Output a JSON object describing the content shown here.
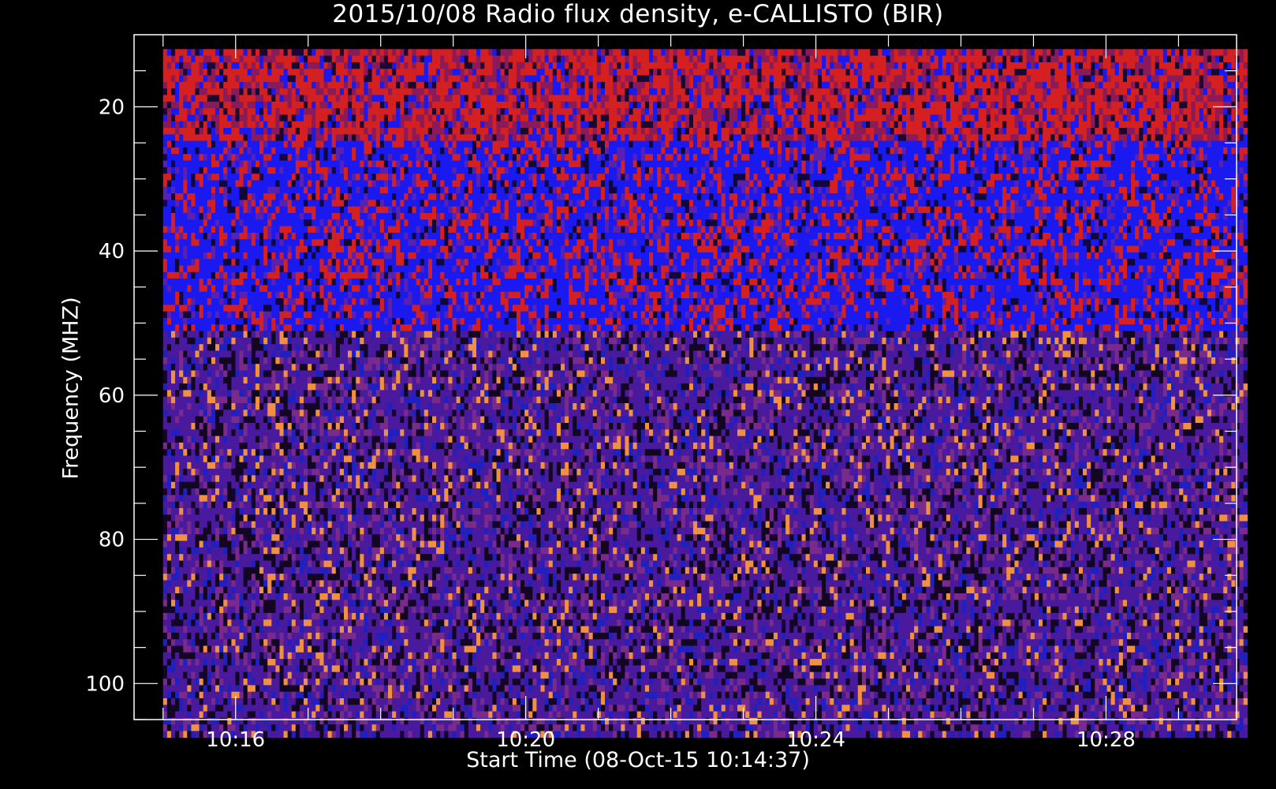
{
  "chart_data": {
    "type": "heatmap",
    "title": "2015/10/08  Radio flux density, e-CALLISTO (BIR)",
    "xlabel": "Start Time (08-Oct-15 10:14:37)",
    "ylabel": "Frequency (MHZ)",
    "x_ticks": [
      "10:16",
      "10:20",
      "10:24",
      "10:28"
    ],
    "y_ticks": [
      "20",
      "40",
      "60",
      "80",
      "100"
    ],
    "x_range_minutes": [
      14.6,
      29.8
    ],
    "data_x_minutes": [
      15.0,
      29.95
    ],
    "y_range_mhz": [
      10,
      105
    ],
    "data_y_mhz": [
      12,
      107.5
    ],
    "y_reversed": true,
    "bands": [
      {
        "from_mhz": 12,
        "to_mhz": 25,
        "dominant": "red"
      },
      {
        "from_mhz": 25,
        "to_mhz": 51,
        "dominant": "blue"
      },
      {
        "from_mhz": 51,
        "to_mhz": 107.5,
        "dominant": "purple"
      }
    ],
    "colors": {
      "background": "#000000",
      "axis": "#ffffff",
      "red": "#d42020",
      "blue": "#1a1af0",
      "purple": "#4a1a9e",
      "orange": "#f09040"
    }
  }
}
